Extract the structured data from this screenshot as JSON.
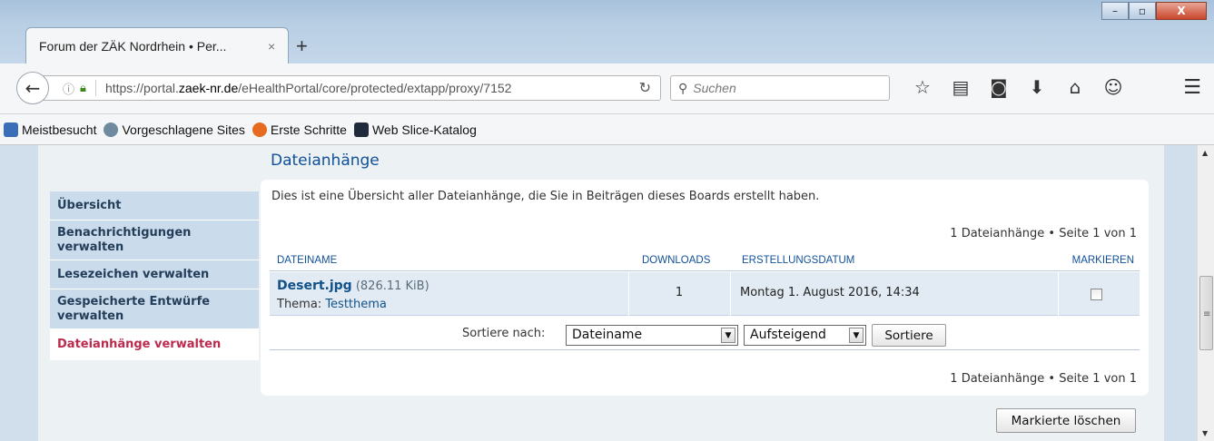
{
  "browser": {
    "tab_title": "Forum der ZÄK Nordrhein • Per...",
    "tab_close": "×",
    "new_tab": "+",
    "window_minimize": "–",
    "window_maximize": "▫",
    "window_close": "X",
    "url_prefix": "https://portal.",
    "url_host": "zaek-nr.de",
    "url_path": "/eHealthPortal/core/protected/extapp/proxy/7152",
    "search_placeholder": "Suchen"
  },
  "bookmarks": [
    {
      "label": "Meistbesucht",
      "icon": "bookmark-icon",
      "color": "#3a6fb8"
    },
    {
      "label": "Vorgeschlagene Sites",
      "icon": "globe-icon",
      "color": "#6d8a9e"
    },
    {
      "label": "Erste Schritte",
      "icon": "firefox-icon",
      "color": "#e66a1f"
    },
    {
      "label": "Web Slice-Katalog",
      "icon": "webslice-icon",
      "color": "#1f2a3d"
    }
  ],
  "page": {
    "section_title": "Dateianhänge",
    "intro": "Dies ist eine Übersicht aller Dateianhänge, die Sie in Beiträgen dieses Boards erstellt haben.",
    "pagination": "1 Dateianhänge • Seite 1 von 1",
    "menu": [
      "Übersicht",
      "Benachrichtigungen verwalten",
      "Lesezeichen verwalten",
      "Gespeicherte Entwürfe verwalten",
      "Dateianhänge verwalten"
    ],
    "columns": {
      "filename": "DATEINAME",
      "downloads": "DOWNLOADS",
      "created": "ERSTELLUNGSDATUM",
      "mark": "MARKIEREN"
    },
    "row": {
      "filename": "Desert.jpg",
      "size": " (826.11 KiB)",
      "thema_label": "Thema: ",
      "thema": "Testthema",
      "downloads": "1",
      "created": "Montag 1. August 2016, 14:34"
    },
    "sort": {
      "label": "Sortiere nach:",
      "field": "Dateiname",
      "direction": "Aufsteigend",
      "button": "Sortiere"
    },
    "delete_button": "Markierte löschen"
  },
  "colors": {
    "accent": "#115098",
    "active_menu": "#bc2a4d"
  }
}
